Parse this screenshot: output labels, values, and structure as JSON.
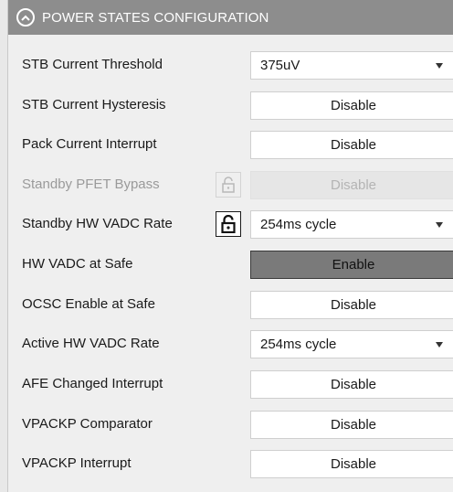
{
  "section": {
    "title": "POWER STATES CONFIGURATION",
    "collapse_icon": "chevron-up-circle-icon"
  },
  "rows": [
    {
      "label": "STB Current Threshold",
      "kind": "select",
      "value": "375uV"
    },
    {
      "label": "STB Current Hysteresis",
      "kind": "button",
      "value": "Disable"
    },
    {
      "label": "Pack Current Interrupt",
      "kind": "button",
      "value": "Disable"
    },
    {
      "label": "Standby PFET Bypass",
      "kind": "button",
      "value": "Disable",
      "disabled": true,
      "lock": "unlocked-padlock-icon"
    },
    {
      "label": "Standby HW VADC Rate",
      "kind": "select",
      "value": "254ms cycle",
      "lock": "unlocked-padlock-icon"
    },
    {
      "label": "HW VADC at Safe",
      "kind": "button",
      "value": "Enable",
      "active": true
    },
    {
      "label": "OCSC Enable at Safe",
      "kind": "button",
      "value": "Disable"
    },
    {
      "label": "Active HW VADC Rate",
      "kind": "select",
      "value": "254ms cycle"
    },
    {
      "label": "AFE Changed Interrupt",
      "kind": "button",
      "value": "Disable"
    },
    {
      "label": "VPACKP Comparator",
      "kind": "button",
      "value": "Disable"
    },
    {
      "label": "VPACKP Interrupt",
      "kind": "button",
      "value": "Disable"
    }
  ]
}
